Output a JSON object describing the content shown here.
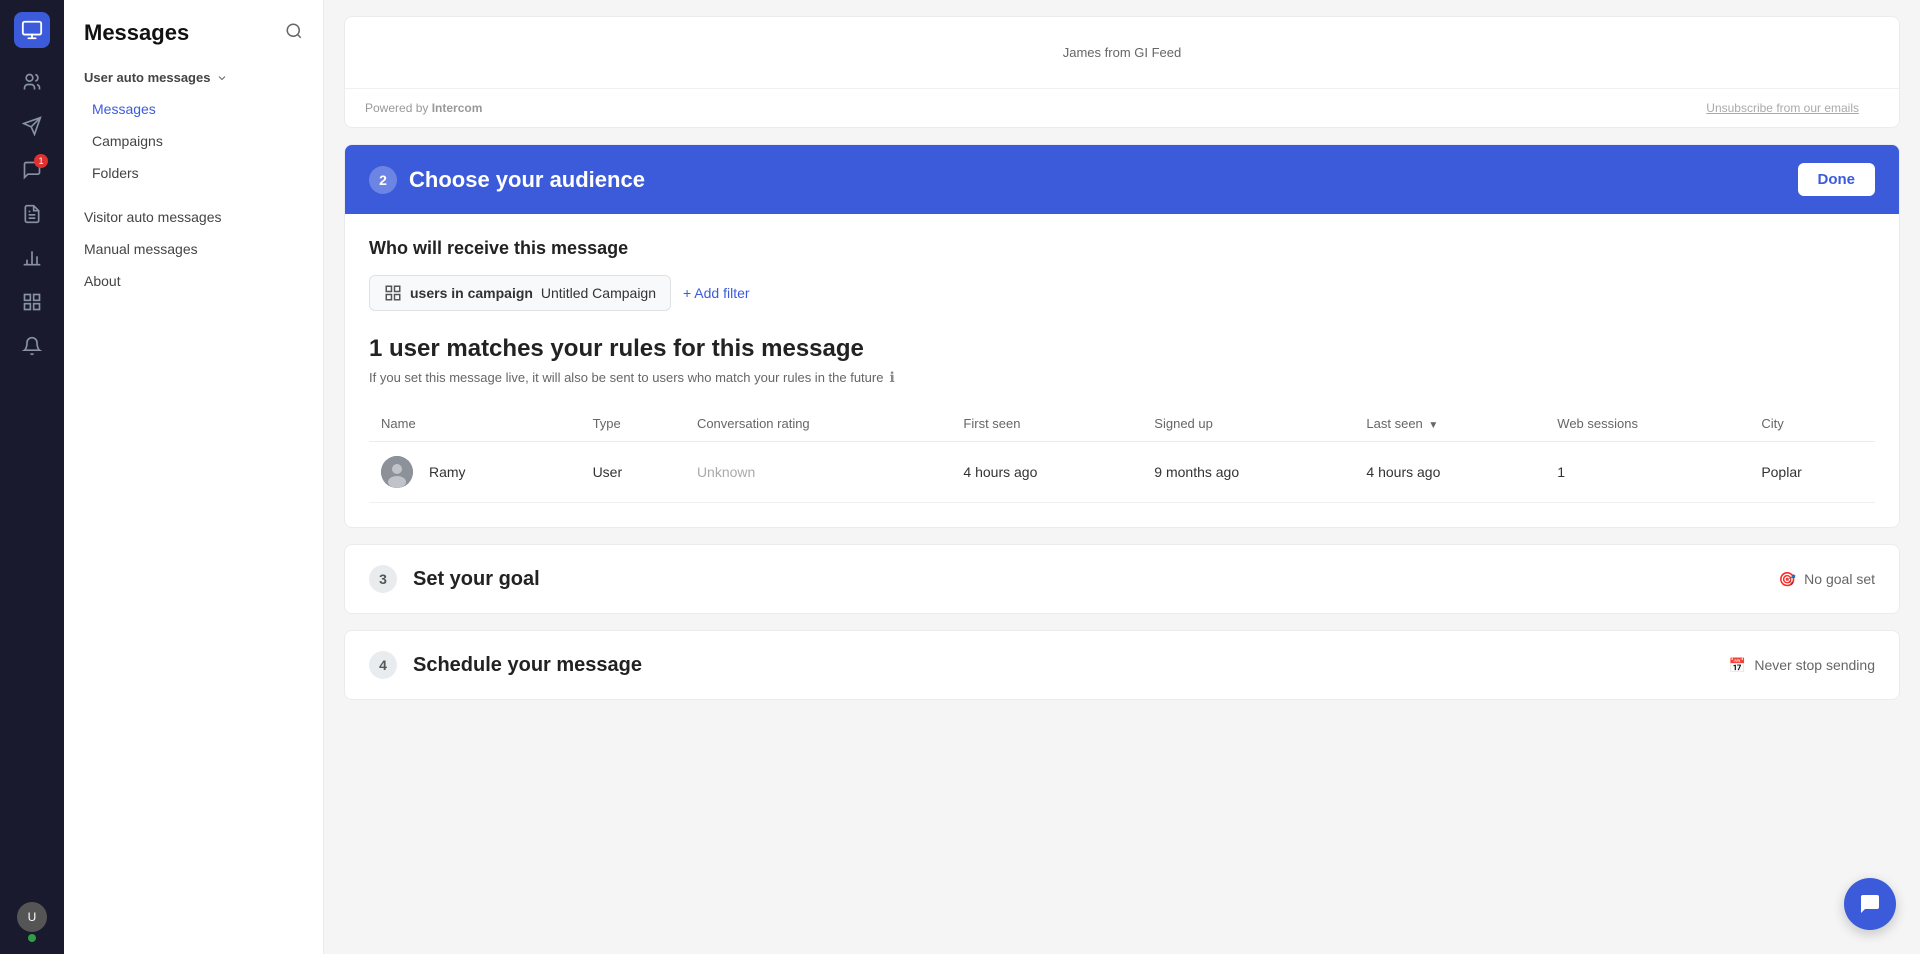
{
  "app": {
    "title": "Messages"
  },
  "sidebar": {
    "nav_items": [
      {
        "id": "messages-icon",
        "icon": "💬",
        "active": false
      },
      {
        "id": "campaigns-icon",
        "icon": "✈",
        "active": false,
        "badge": null
      },
      {
        "id": "inbox-icon",
        "icon": "📥",
        "active": false,
        "badge": "1"
      },
      {
        "id": "articles-icon",
        "icon": "📄",
        "active": false
      },
      {
        "id": "reports-icon",
        "icon": "📊",
        "active": false
      },
      {
        "id": "apps-icon",
        "icon": "⊞",
        "active": false
      },
      {
        "id": "alerts-icon",
        "icon": "🔔",
        "active": false
      }
    ],
    "avatar_initials": "U",
    "green_dot": true
  },
  "nav_panel": {
    "title": "Messages",
    "sections": [
      {
        "label": "User auto messages",
        "has_dropdown": true,
        "items": [
          {
            "label": "Messages",
            "active": true
          },
          {
            "label": "Campaigns",
            "active": false
          },
          {
            "label": "Folders",
            "active": false
          }
        ]
      }
    ],
    "top_items": [
      {
        "label": "Visitor auto messages",
        "active": false
      },
      {
        "label": "Manual messages",
        "active": false
      },
      {
        "label": "About",
        "active": false
      }
    ]
  },
  "email_preview": {
    "sender_text": "James from GI Feed",
    "unsubscribe_text": "Unsubscribe from our emails",
    "powered_by_text": "Powered by",
    "powered_by_brand": "Intercom"
  },
  "audience_section": {
    "step_number": "2",
    "title": "Choose your audience",
    "done_button": "Done",
    "who_receives_label": "Who will receive this message",
    "filter": {
      "icon": "⊞",
      "prefix_text": "users in campaign",
      "value": "Untitled Campaign"
    },
    "add_filter_label": "+ Add filter",
    "match_count": "1 user matches your rules for this message",
    "match_sub_text": "If you set this message live, it will also be sent to users who match your rules in the future",
    "table": {
      "columns": [
        {
          "label": "Name",
          "sortable": false
        },
        {
          "label": "Type",
          "sortable": false
        },
        {
          "label": "Conversation rating",
          "sortable": false
        },
        {
          "label": "First seen",
          "sortable": false
        },
        {
          "label": "Signed up",
          "sortable": false
        },
        {
          "label": "Last seen",
          "sortable": true
        },
        {
          "label": "Web sessions",
          "sortable": false
        },
        {
          "label": "City",
          "sortable": false
        }
      ],
      "rows": [
        {
          "name": "Ramy",
          "type": "User",
          "conversation_rating": "Unknown",
          "first_seen": "4 hours ago",
          "signed_up": "9 months ago",
          "last_seen": "4 hours ago",
          "web_sessions": "1",
          "city": "Poplar"
        }
      ]
    }
  },
  "goal_section": {
    "step_number": "3",
    "title": "Set your goal",
    "status_icon": "🎯",
    "status_text": "No goal set"
  },
  "schedule_section": {
    "step_number": "4",
    "title": "Schedule your message",
    "status_icon": "📅",
    "status_text": "Never stop sending"
  }
}
